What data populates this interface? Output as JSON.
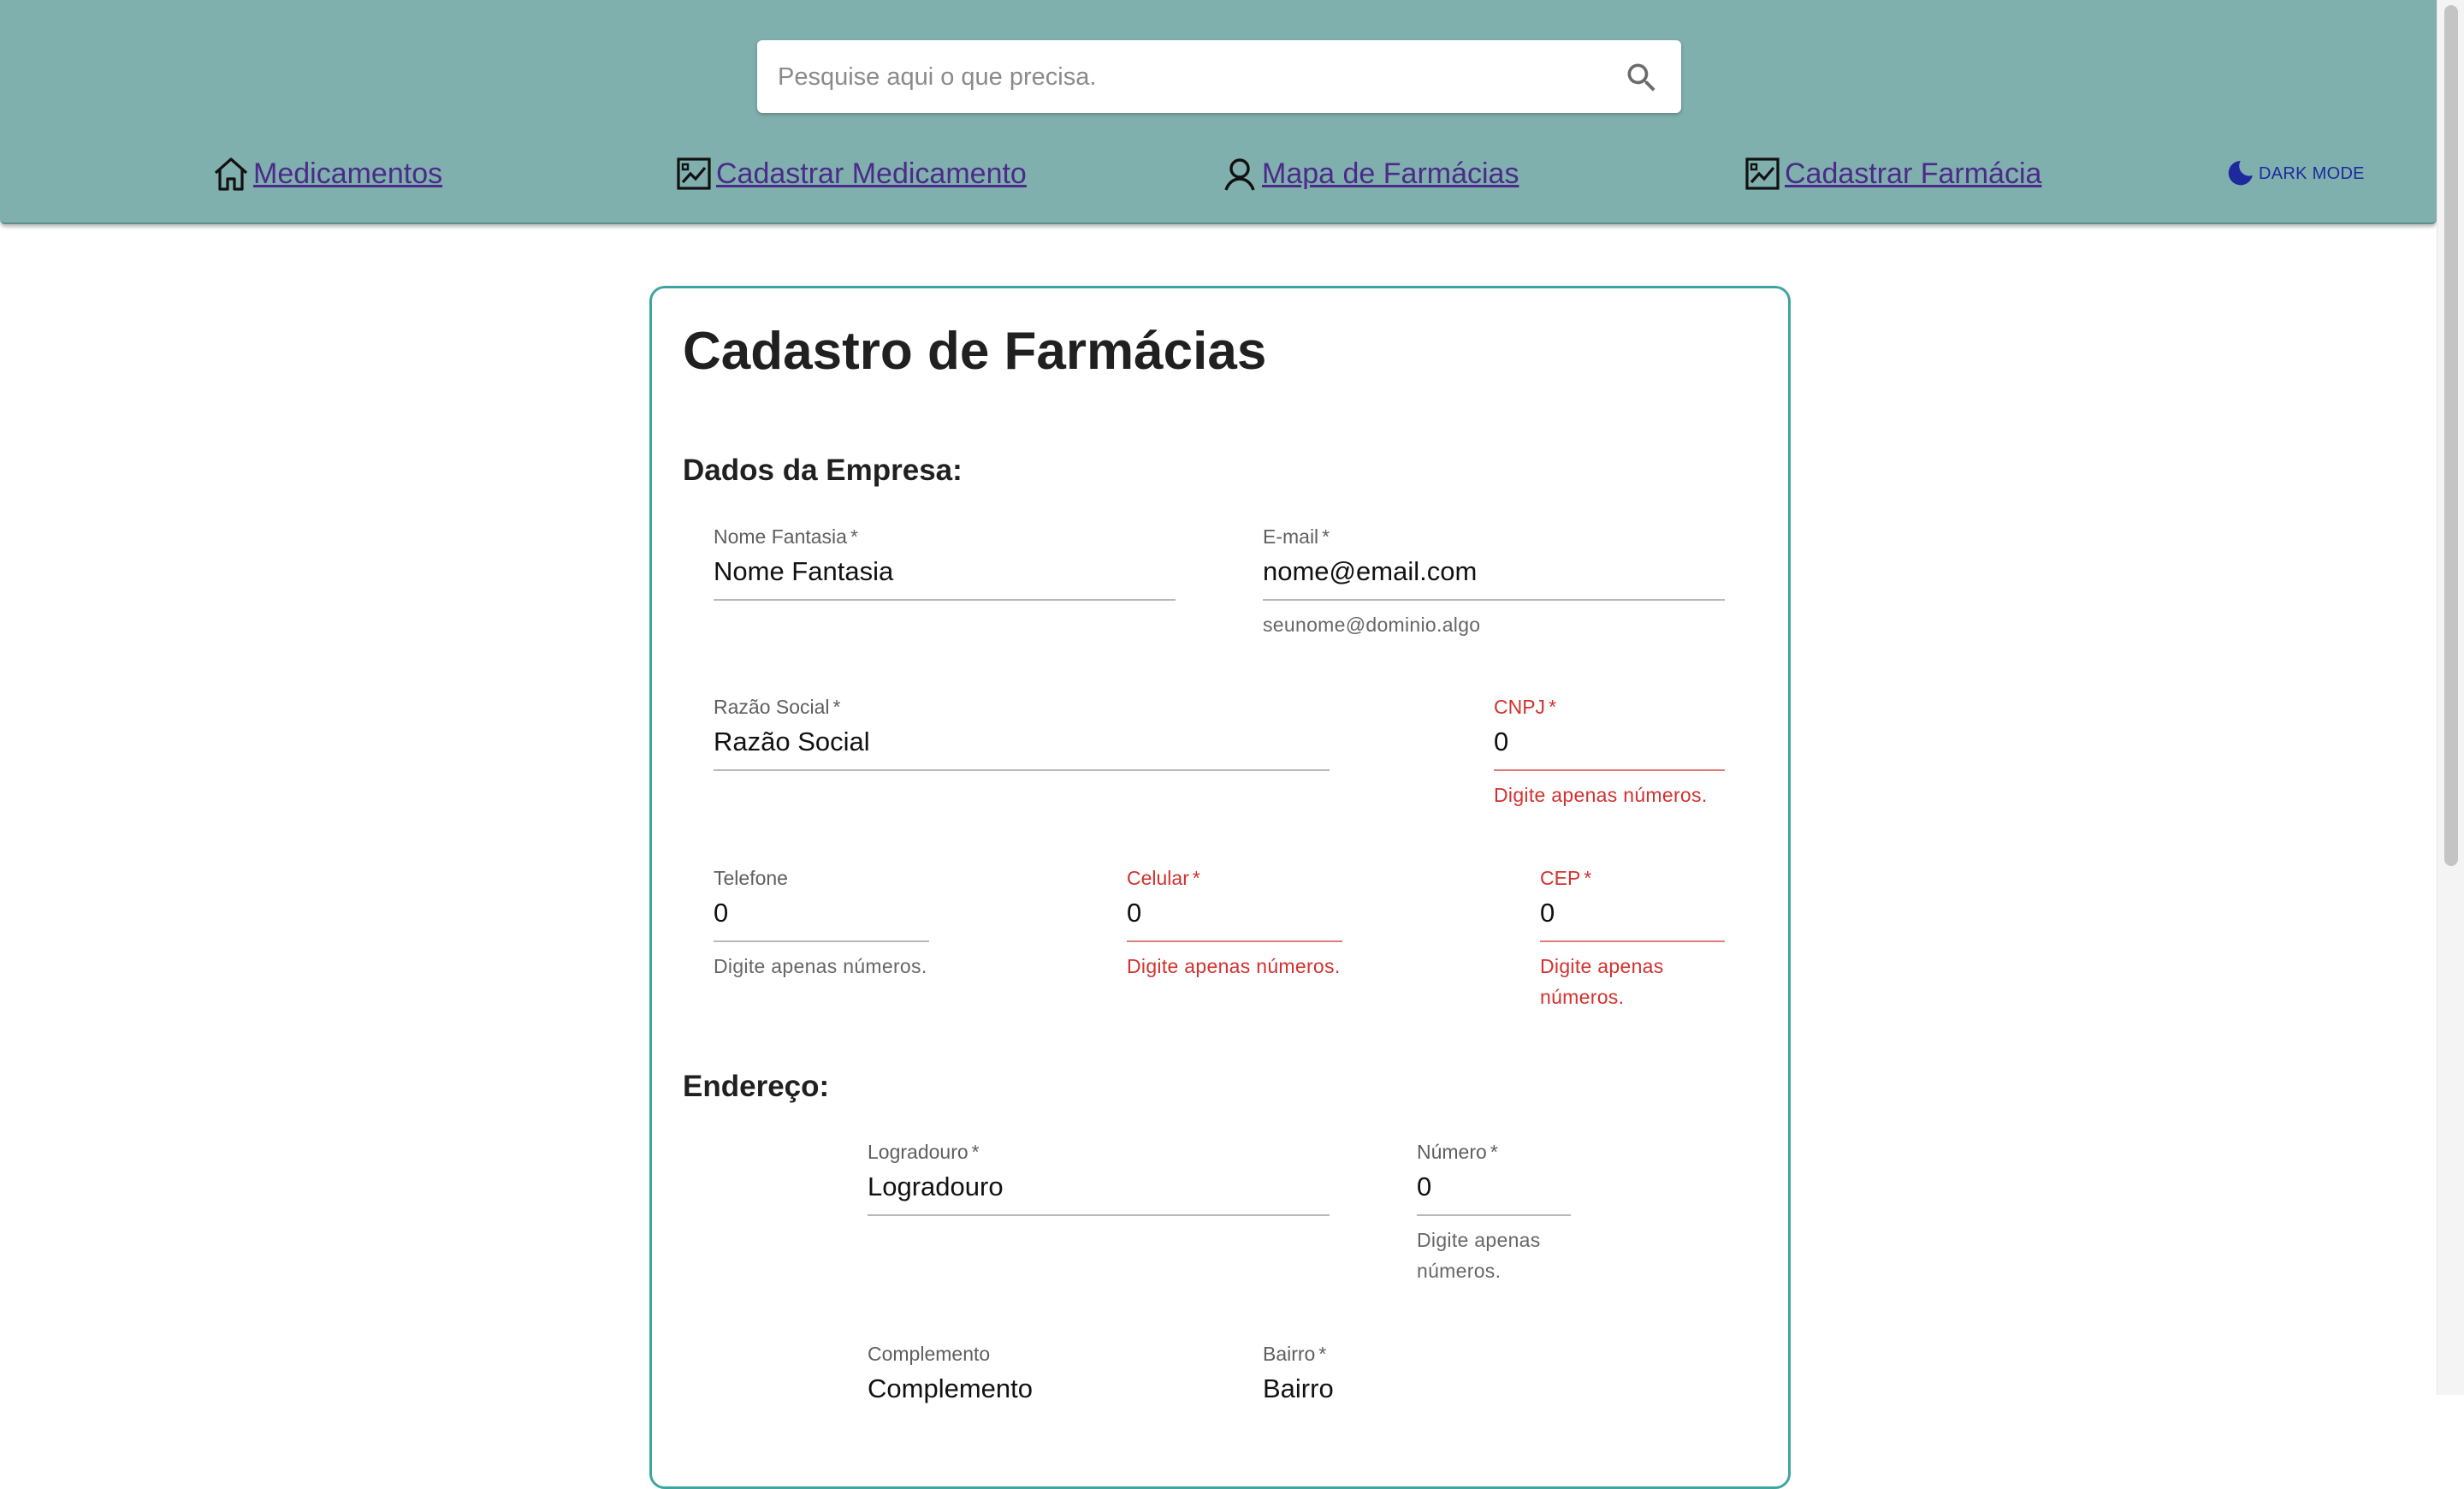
{
  "search": {
    "placeholder": "Pesquise aqui o que precisa.",
    "icon": "search-icon"
  },
  "nav": [
    {
      "label": "Medicamentos",
      "icon": "home-icon"
    },
    {
      "label": "Cadastrar Medicamento",
      "icon": "chart-image-icon"
    },
    {
      "label": "Mapa de Farmácias",
      "icon": "person-icon"
    },
    {
      "label": "Cadastrar Farmácia",
      "icon": "chart-image-icon"
    }
  ],
  "dark_mode": {
    "label": "DARK MODE",
    "icon": "moon-icon"
  },
  "colors": {
    "header_bg": "#80b0ae",
    "accent": "#3fa5a0",
    "link": "#4b2a8a",
    "error": "#d2312f",
    "dark_mode": "#1d2a9c"
  },
  "form": {
    "title": "Cadastro de Farmácias",
    "section_company": "Dados da Empresa:",
    "section_address": "Endereço:",
    "required_mark": "*",
    "fields": {
      "nome_fantasia": {
        "label": "Nome Fantasia",
        "value": "Nome Fantasia"
      },
      "email": {
        "label": "E-mail",
        "value": "nome@email.com",
        "help": "seunome@dominio.algo"
      },
      "razao_social": {
        "label": "Razão Social",
        "value": "Razão Social"
      },
      "cnpj": {
        "label": "CNPJ",
        "value": "0",
        "help": "Digite apenas números."
      },
      "telefone": {
        "label": "Telefone",
        "value": "0",
        "help": "Digite apenas números."
      },
      "celular": {
        "label": "Celular",
        "value": "0",
        "help": "Digite apenas números."
      },
      "cep": {
        "label": "CEP",
        "value": "0",
        "help_line1": "Digite apenas",
        "help_line2": "números."
      },
      "logradouro": {
        "label": "Logradouro",
        "value": "Logradouro"
      },
      "numero": {
        "label": "Número",
        "value": "0",
        "help_line1": "Digite apenas",
        "help_line2": "números."
      },
      "complemento": {
        "label": "Complemento",
        "value": "Complemento"
      },
      "bairro": {
        "label": "Bairro",
        "value": "Bairro"
      }
    }
  }
}
